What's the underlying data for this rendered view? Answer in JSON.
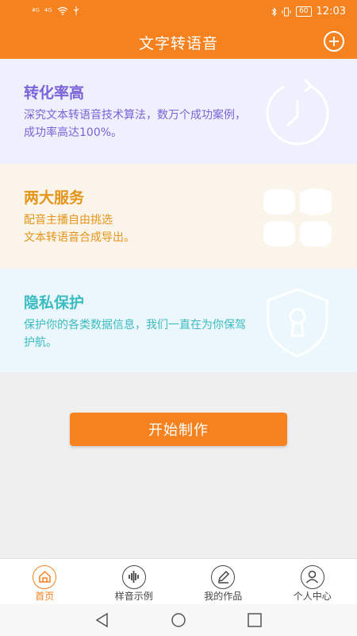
{
  "status": {
    "signal1": "⁴ᴳ",
    "signal2": "⁴ᴳ",
    "battery": "60",
    "time": "12:03"
  },
  "header": {
    "title": "文字转语音"
  },
  "cards": [
    {
      "title": "转化率高",
      "desc": "深究文本转语音技术算法，数万个成功案例，成功率高达100%。",
      "icon": "refresh-clock-icon"
    },
    {
      "title": "两大服务",
      "desc_line1": "配音主播自由挑选",
      "desc_line2": "文本转语音合成导出。",
      "icon": "grid-services-icon"
    },
    {
      "title": "隐私保护",
      "desc": "保护你的各类数据信息，我们一直在为你保驾护航。",
      "icon": "shield-lock-icon"
    }
  ],
  "main": {
    "start_label": "开始制作"
  },
  "tabs": [
    {
      "label": "首页",
      "icon": "home-icon",
      "active": true
    },
    {
      "label": "样音示例",
      "icon": "waveform-icon",
      "active": false
    },
    {
      "label": "我的作品",
      "icon": "pencil-icon",
      "active": false
    },
    {
      "label": "个人中心",
      "icon": "user-icon",
      "active": false
    }
  ],
  "colors": {
    "accent": "#f5821f",
    "card1_text": "#7a62d8",
    "card2_text": "#e49417",
    "card3_text": "#3bbcc1"
  }
}
